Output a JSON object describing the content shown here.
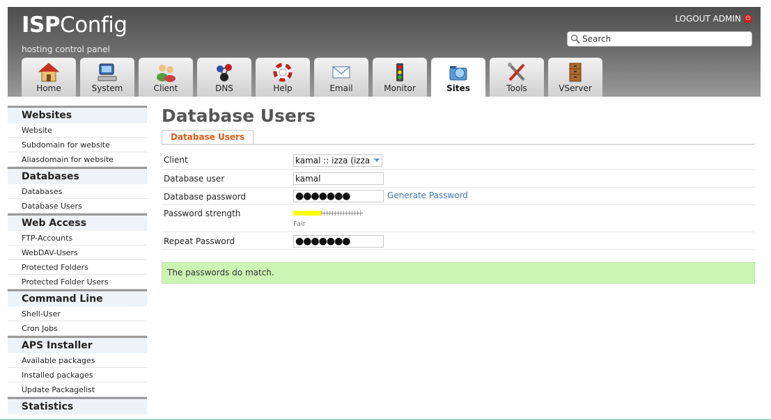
{
  "header": {
    "logo_bold": "ISP",
    "logo_rest": "Config",
    "tagline": "hosting control panel",
    "logout_label": "LOGOUT ADMIN",
    "search_placeholder": "Search"
  },
  "tabs": [
    {
      "label": "Home",
      "icon": "home-icon"
    },
    {
      "label": "System",
      "icon": "system-icon"
    },
    {
      "label": "Client",
      "icon": "client-icon"
    },
    {
      "label": "DNS",
      "icon": "dns-icon"
    },
    {
      "label": "Help",
      "icon": "help-icon"
    },
    {
      "label": "Email",
      "icon": "email-icon"
    },
    {
      "label": "Monitor",
      "icon": "monitor-icon"
    },
    {
      "label": "Sites",
      "icon": "sites-icon",
      "active": true
    },
    {
      "label": "Tools",
      "icon": "tools-icon"
    },
    {
      "label": "VServer",
      "icon": "vserver-icon"
    }
  ],
  "sidebar": {
    "sections": [
      {
        "title": "Websites",
        "items": [
          "Website",
          "Subdomain for website",
          "Aliasdomain for website"
        ]
      },
      {
        "title": "Databases",
        "items": [
          "Databases",
          "Database Users"
        ]
      },
      {
        "title": "Web Access",
        "items": [
          "FTP-Accounts",
          "WebDAV-Users",
          "Protected Folders",
          "Protected Folder Users"
        ]
      },
      {
        "title": "Command Line",
        "items": [
          "Shell-User",
          "Cron Jobs"
        ]
      },
      {
        "title": "APS Installer",
        "items": [
          "Available packages",
          "Installed packages",
          "Update Packagelist"
        ]
      },
      {
        "title": "Statistics",
        "items": []
      }
    ]
  },
  "main": {
    "title": "Database Users",
    "subtab": "Database Users",
    "form": {
      "client_label": "Client",
      "client_value": "kamal :: izza (izza",
      "db_user_label": "Database user",
      "db_user_value": "kamal",
      "db_password_label": "Database password",
      "db_password_value": "●●●●●●●",
      "generate_password": "Generate Password",
      "strength_label": "Password strength",
      "strength_value": 0.4,
      "strength_text": "Fair",
      "strength_color": "#ffff00",
      "repeat_label": "Repeat Password",
      "repeat_value": "●●●●●●●"
    },
    "message": "The passwords do match."
  }
}
